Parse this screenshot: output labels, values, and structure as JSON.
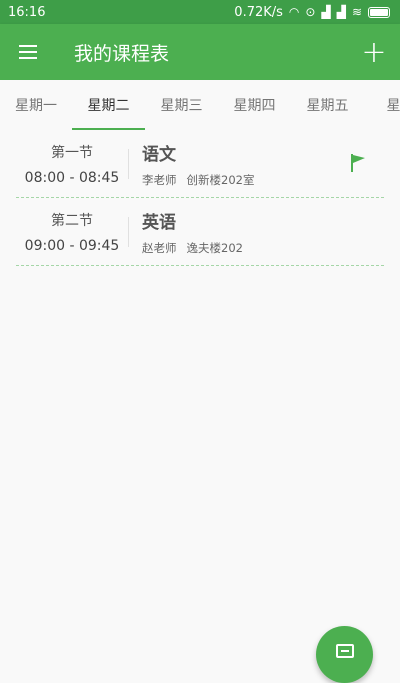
{
  "status_bar": {
    "time": "16:16",
    "network_speed": "0.72K/s",
    "battery_level": 1.0
  },
  "toolbar": {
    "title": "我的课程表",
    "menu_icon": "menu-icon",
    "add_icon": "add-icon"
  },
  "tabs": [
    {
      "label": "星期一",
      "active": false
    },
    {
      "label": "星期二",
      "active": true
    },
    {
      "label": "星期三",
      "active": false
    },
    {
      "label": "星期四",
      "active": false
    },
    {
      "label": "星期五",
      "active": false
    },
    {
      "label": "星期",
      "active": false
    }
  ],
  "courses": [
    {
      "period": "第一节",
      "time": "08:00 - 08:45",
      "name": "语文",
      "teacher": "李老师",
      "room": "创新楼202室",
      "flagged": true
    },
    {
      "period": "第二节",
      "time": "09:00 - 09:45",
      "name": "英语",
      "teacher": "赵老师",
      "room": "逸夫楼202",
      "flagged": false
    }
  ],
  "colors": {
    "status_bar": "#3e9e48",
    "primary": "#4caf50",
    "divider": "#a5d6a7"
  }
}
